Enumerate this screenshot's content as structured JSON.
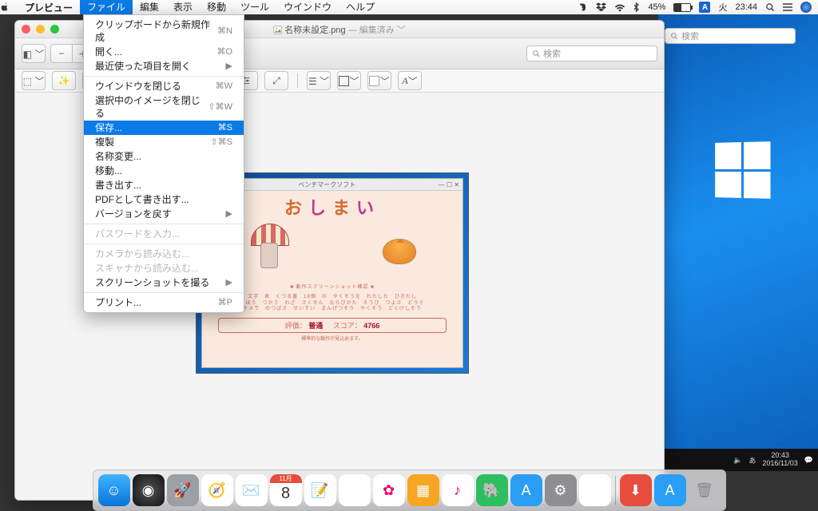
{
  "menubar": {
    "app_name": "プレビュー",
    "items": [
      "ファイル",
      "編集",
      "表示",
      "移動",
      "ツール",
      "ウインドウ",
      "ヘルプ"
    ],
    "selected_index": 0,
    "right": {
      "battery_pct": "45%",
      "ime_label": "A",
      "day": "火",
      "time": "23:44"
    }
  },
  "dropdown": {
    "groups": [
      [
        {
          "label": "クリップボードから新規作成",
          "shortcut": "⌘N"
        },
        {
          "label": "開く...",
          "shortcut": "⌘O"
        },
        {
          "label": "最近使った項目を開く",
          "submenu": true
        }
      ],
      [
        {
          "label": "ウインドウを閉じる",
          "shortcut": "⌘W"
        },
        {
          "label": "選択中のイメージを閉じる",
          "shortcut": "⇧⌘W"
        },
        {
          "label": "保存...",
          "shortcut": "⌘S",
          "selected": true
        },
        {
          "label": "複製",
          "shortcut": "⇧⌘S"
        },
        {
          "label": "名称変更..."
        },
        {
          "label": "移動..."
        },
        {
          "label": "書き出す..."
        },
        {
          "label": "PDFとして書き出す..."
        },
        {
          "label": "バージョンを戻す",
          "submenu": true
        }
      ],
      [
        {
          "label": "パスワードを入力...",
          "disabled": true
        }
      ],
      [
        {
          "label": "カメラから読み込む...",
          "disabled": true
        },
        {
          "label": "スキャナから読み込む...",
          "disabled": true
        },
        {
          "label": "スクリーンショットを撮る",
          "submenu": true
        }
      ],
      [
        {
          "label": "プリント...",
          "shortcut": "⌘P"
        }
      ]
    ]
  },
  "window": {
    "filename": "名称未設定.png",
    "status": "編集済み",
    "search_placeholder": "検索"
  },
  "back_window": {
    "search_placeholder": "検索"
  },
  "image_content": {
    "inner_title": "ベンチマークソフト",
    "big_title": [
      "お",
      "し",
      "ま",
      "い"
    ],
    "caption": "■ 動作スクリーンショット確認 ■",
    "lines": [
      "文字　表　くつる番　18個　の　やくそうを　わたした　ひきだし",
      "まほう　つかう　わざ　さくせん　ならびかた　そうび　つよさ　どうぐ",
      "キメラ　のつばさ　せいすい　まんげつそう　やくそう　どくけしそう"
    ],
    "score_label_l": "評価：",
    "score_val_l": "普通",
    "score_label_r": "スコア：",
    "score_val_r": "4766",
    "footnote": "標準的な動作が見込めます。"
  },
  "win_taskbar": {
    "ime": "あ",
    "time": "20:43",
    "date": "2016/11/03"
  },
  "dock": {
    "apps": [
      {
        "name": "finder",
        "bg": "linear-gradient(#3fb4ff,#0a74d8)",
        "glyph": "☺"
      },
      {
        "name": "siri",
        "bg": "radial-gradient(circle,#555,#111)",
        "glyph": "◉"
      },
      {
        "name": "launchpad",
        "bg": "#9aa0a6",
        "glyph": "🚀"
      },
      {
        "name": "safari",
        "bg": "#fff",
        "glyph": "🧭"
      },
      {
        "name": "mail",
        "bg": "#fff",
        "glyph": "✉️"
      },
      {
        "name": "calendar",
        "bg": "#fff",
        "glyph": "8",
        "text": "#e33"
      },
      {
        "name": "notes",
        "bg": "#fff",
        "glyph": "📝"
      },
      {
        "name": "reminders",
        "bg": "#fff",
        "glyph": "☑"
      },
      {
        "name": "photos",
        "bg": "#fff",
        "glyph": "✿",
        "text": "#e06"
      },
      {
        "name": "pixelmator",
        "bg": "#f5a623",
        "glyph": "▦"
      },
      {
        "name": "itunes",
        "bg": "#fff",
        "glyph": "♪",
        "text": "#e06"
      },
      {
        "name": "evernote",
        "bg": "#2dbe60",
        "glyph": "🐘"
      },
      {
        "name": "appstore",
        "bg": "#2a9df4",
        "glyph": "A"
      },
      {
        "name": "preferences",
        "bg": "#8e8e93",
        "glyph": "⚙"
      },
      {
        "name": "preview",
        "bg": "#fff",
        "glyph": "🖼"
      }
    ],
    "right": [
      {
        "name": "downloads",
        "bg": "#e74c3c",
        "glyph": "⬇"
      },
      {
        "name": "appstore2",
        "bg": "#2a9df4",
        "glyph": "A"
      },
      {
        "name": "trash",
        "bg": "transparent",
        "glyph": "🗑",
        "text": "#888"
      }
    ],
    "cal_month": "11月"
  }
}
